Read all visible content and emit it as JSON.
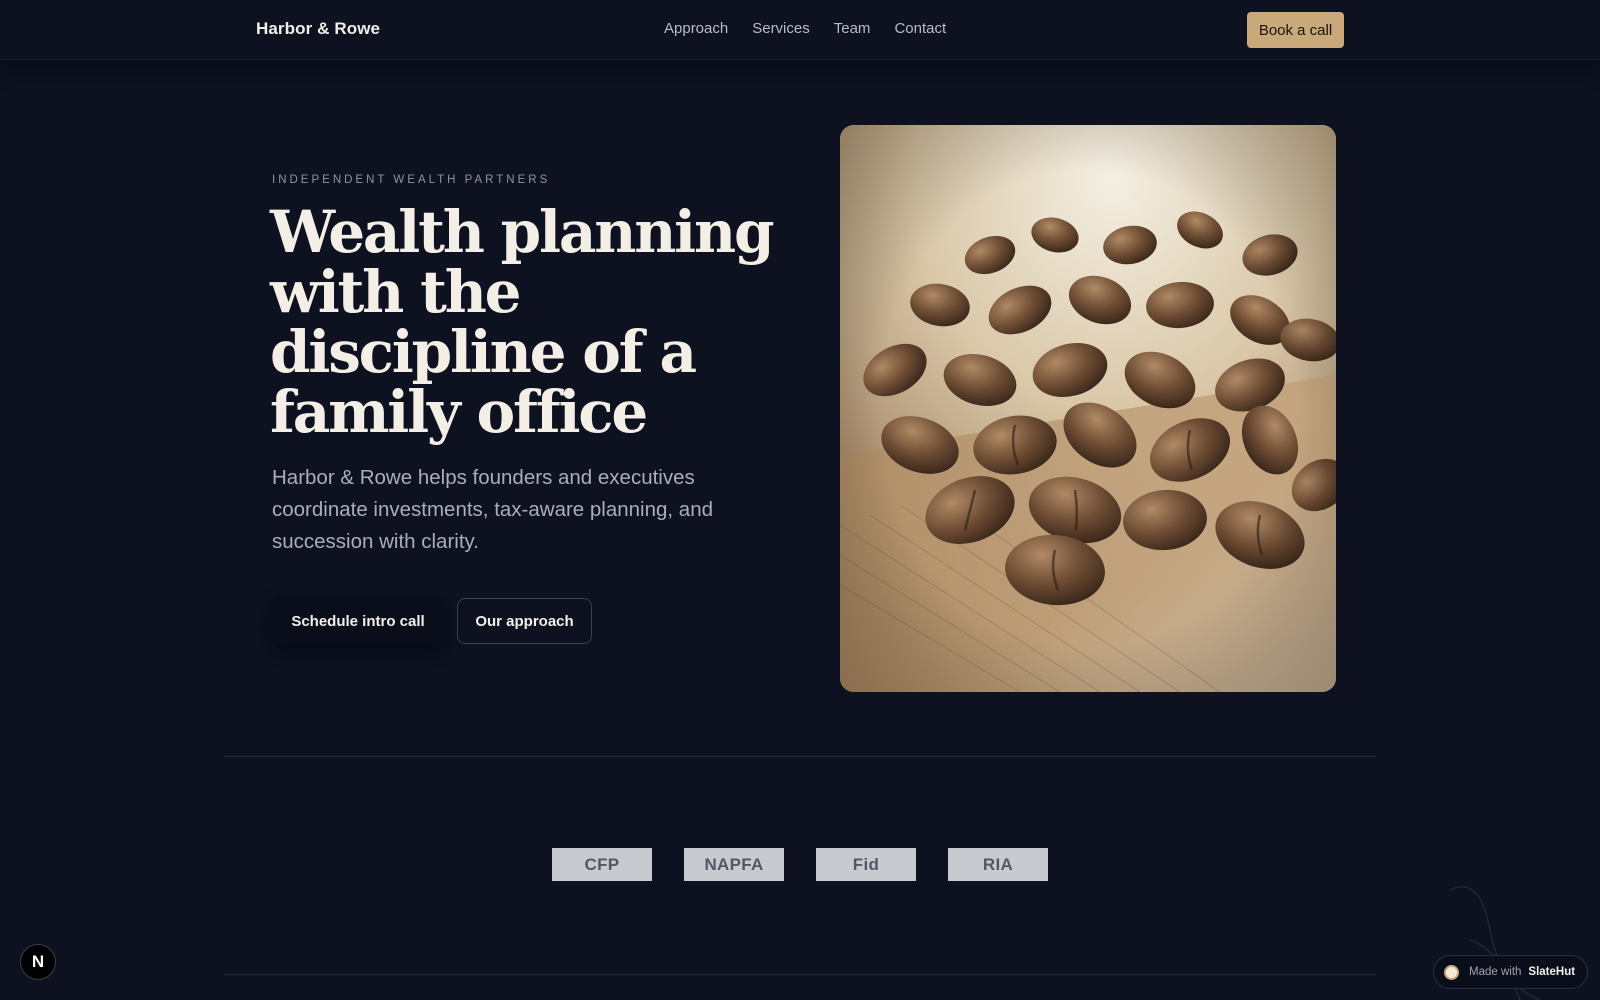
{
  "header": {
    "brand": "Harbor & Rowe",
    "nav": [
      "Approach",
      "Services",
      "Team",
      "Contact"
    ],
    "cta": "Book a call"
  },
  "hero": {
    "eyebrow": "INDEPENDENT WEALTH PARTNERS",
    "title_lines": [
      "Wealth planning",
      "with the",
      "discipline of a",
      "family office"
    ],
    "subtitle": "Harbor & Rowe helps founders and executives coordinate investments, tax-aware planning, and succession with clarity.",
    "primary_button": "Schedule intro call",
    "secondary_button": "Our approach",
    "image_subject": "coffee beans on wooden surface (sepia photo)"
  },
  "logos": [
    "CFP",
    "NAPFA",
    "Fid",
    "RIA"
  ],
  "widgets": {
    "n_badge": "N",
    "made_with_prefix": "Made with",
    "made_with_brand": "SlateHut"
  },
  "colors": {
    "background": "#0d1120",
    "accent": "#c9a879",
    "text": "#f4efe6",
    "muted": "#a9aebb"
  }
}
